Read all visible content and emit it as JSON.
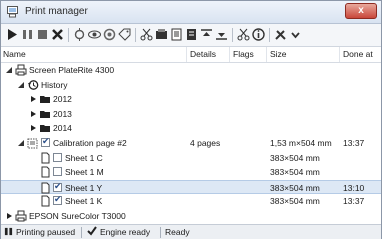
{
  "window": {
    "title": "Print manager",
    "close_label": "x"
  },
  "toolbar": {
    "buttons": [
      "play-icon",
      "pause-icon",
      "stop-icon",
      "delete-icon",
      "filter-icon",
      "view-icon",
      "settings-icon",
      "tag-icon",
      "cut-icon",
      "layout-icon",
      "page-icon",
      "export-icon",
      "align-top-icon",
      "align-bottom-icon",
      "scissors-icon",
      "info-icon",
      "tools-icon",
      "more-icon"
    ]
  },
  "columns": {
    "name": "Name",
    "details": "Details",
    "flags": "Flags",
    "size": "Size",
    "done_at": "Done at"
  },
  "tree": [
    {
      "name": "Screen PlateRite 4300",
      "type": "printer",
      "level": 0,
      "expanded": true
    },
    {
      "name": "History",
      "type": "history",
      "level": 1,
      "expanded": true
    },
    {
      "name": "2012",
      "type": "folder",
      "level": 2,
      "expanded": false
    },
    {
      "name": "2013",
      "type": "folder",
      "level": 2,
      "expanded": false
    },
    {
      "name": "2014",
      "type": "folder",
      "level": 2,
      "expanded": false
    },
    {
      "name": "Calibration page #2",
      "type": "job",
      "level": 1,
      "expanded": true,
      "checked": true,
      "details": "4 pages",
      "size": "1,53 m×504 mm",
      "done": "13:37"
    },
    {
      "name": "Sheet 1 C",
      "type": "sheet",
      "level": 2,
      "checked": false,
      "size": "383×504 mm",
      "done": ""
    },
    {
      "name": "Sheet 1 M",
      "type": "sheet",
      "level": 2,
      "checked": false,
      "size": "383×504 mm",
      "done": ""
    },
    {
      "name": "Sheet 1 Y",
      "type": "sheet",
      "level": 2,
      "checked": true,
      "size": "383×504 mm",
      "done": "13:10",
      "selected": true
    },
    {
      "name": "Sheet 1 K",
      "type": "sheet",
      "level": 2,
      "checked": true,
      "size": "383×504 mm",
      "done": "13:37"
    },
    {
      "name": "EPSON SureColor T3000",
      "type": "printer",
      "level": 0,
      "expanded": false
    }
  ],
  "status": {
    "paused": "Printing paused",
    "engine": "Engine ready",
    "ready": "Ready"
  }
}
